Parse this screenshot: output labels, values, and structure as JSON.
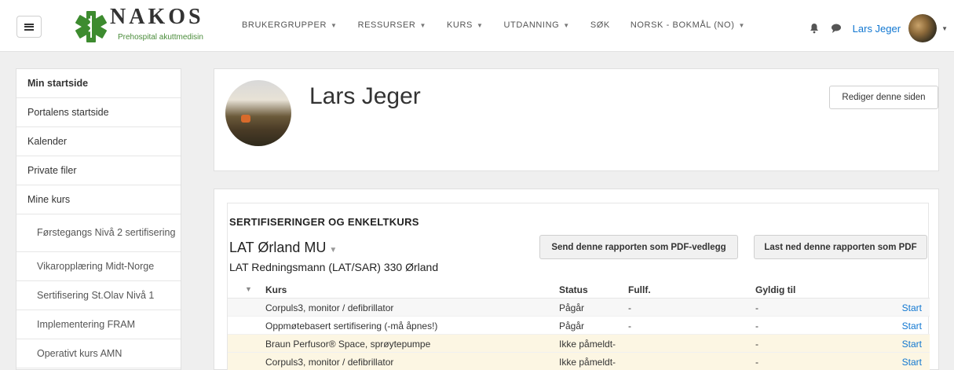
{
  "navbar": {
    "logo_text": "NAKOS",
    "logo_subtitle": "Prehospital akuttmedisin",
    "menu": [
      {
        "label": "BRUKERGRUPPER"
      },
      {
        "label": "RESSURSER"
      },
      {
        "label": "KURS"
      },
      {
        "label": "UTDANNING"
      },
      {
        "label": "SØK"
      },
      {
        "label": "NORSK - BOKMÅL (NO)"
      }
    ],
    "user_name": "Lars Jeger"
  },
  "drawer": {
    "items": [
      {
        "label": "Min startside"
      },
      {
        "label": "Portalens startside"
      },
      {
        "label": "Kalender"
      },
      {
        "label": "Private filer"
      },
      {
        "label": "Mine kurs"
      },
      {
        "label": "Førstegangs Nivå 2 sertifisering"
      },
      {
        "label": "Vikaropplæring Midt-Norge"
      },
      {
        "label": "Sertifisering St.Olav Nivå 1"
      },
      {
        "label": "Implementering FRAM"
      },
      {
        "label": "Operativt kurs AMN"
      }
    ]
  },
  "profile": {
    "name": "Lars Jeger",
    "edit_button": "Rediger denne siden"
  },
  "report": {
    "section_title": "SERTIFISERINGER OG ENKELTKURS",
    "org_name": "LAT Ørland MU",
    "org_sub": "LAT Redningsmann (LAT/SAR) 330 Ørland",
    "send_pdf_button": "Send denne rapporten som PDF-vedlegg",
    "download_pdf_button": "Last ned denne rapporten som PDF",
    "columns": {
      "course": "Kurs",
      "status": "Status",
      "completed": "Fullf.",
      "valid_until": "Gyldig til"
    },
    "rows": [
      {
        "course": "Corpuls3, monitor / defibrillator",
        "status": "Pågår",
        "completed": "-",
        "valid_until": "-",
        "action": "Start"
      },
      {
        "course": "Oppmøtebasert sertifisering (-må åpnes!)",
        "status": "Pågår",
        "completed": "-",
        "valid_until": "-",
        "action": "Start"
      },
      {
        "course": "Braun Perfusor® Space, sprøytepumpe",
        "status": "Ikke påmeldt",
        "completed": "-",
        "valid_until": "-",
        "action": "Start"
      },
      {
        "course": "Corpuls3, monitor / defibrillator",
        "status": "Ikke påmeldt",
        "completed": "-",
        "valid_until": "-",
        "action": "Start"
      }
    ]
  },
  "colors": {
    "link": "#1177d1",
    "highlight_row": "#fcf6e3",
    "logo_green": "#3d8b2f"
  }
}
